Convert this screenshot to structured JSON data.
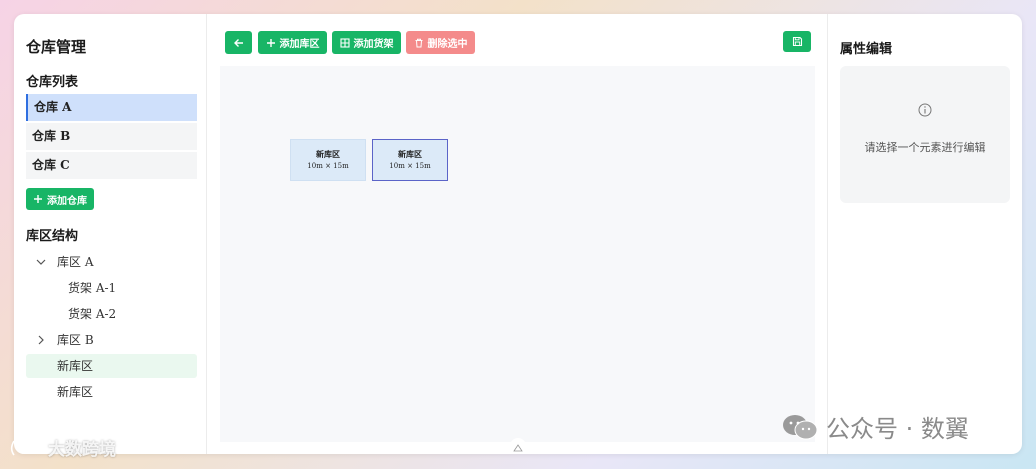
{
  "sidebar": {
    "title": "仓库管理",
    "warehouse_list_title": "仓库列表",
    "warehouses": [
      {
        "label": "仓库 A",
        "active": true
      },
      {
        "label": "仓库 B",
        "active": false
      },
      {
        "label": "仓库 C",
        "active": false
      }
    ],
    "add_warehouse_label": "添加仓库",
    "structure_title": "库区结构",
    "tree": [
      {
        "label": "库区 A",
        "level": 0,
        "expanded": true
      },
      {
        "label": "货架 A-1",
        "level": 1
      },
      {
        "label": "货架 A-2",
        "level": 1
      },
      {
        "label": "库区 B",
        "level": 0,
        "expanded": false
      },
      {
        "label": "新库区",
        "level": 0,
        "selected": true
      },
      {
        "label": "新库区",
        "level": 0
      }
    ]
  },
  "toolbar": {
    "back_icon": "arrow-left-icon",
    "add_zone_label": "添加库区",
    "add_shelf_label": "添加货架",
    "delete_selected_label": "删除选中",
    "save_icon": "save-icon"
  },
  "canvas": {
    "zones": [
      {
        "name": "新库区",
        "dimensions": "10m × 15m",
        "selected": false
      },
      {
        "name": "新库区",
        "dimensions": "10m × 15m",
        "selected": true
      }
    ]
  },
  "properties": {
    "title": "属性编辑",
    "empty_text": "请选择一个元素进行编辑"
  },
  "watermarks": {
    "left": "大数跨境",
    "right": "公众号 · 数翼"
  },
  "colors": {
    "primary": "#18b566",
    "danger": "#f48b8b",
    "active_item": "#cfe0fb",
    "selected_zone_border": "#5b64c8"
  }
}
